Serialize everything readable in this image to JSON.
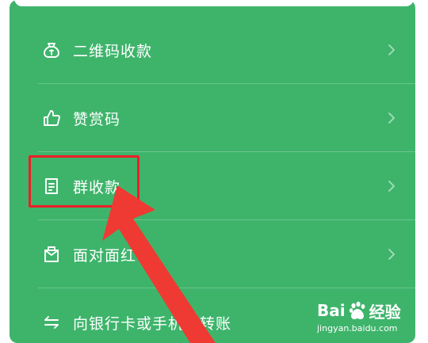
{
  "menu": {
    "items": [
      {
        "label": "二维码收款",
        "icon": "money-bag-icon"
      },
      {
        "label": "赞赏码",
        "icon": "thumbs-up-icon"
      },
      {
        "label": "群收款",
        "icon": "receipt-icon"
      },
      {
        "label": "面对面红包",
        "icon": "red-packet-icon"
      },
      {
        "label": "向银行卡或手机号转账",
        "icon": "transfer-arrows-icon"
      }
    ]
  },
  "watermark": {
    "brand_left": "Bai",
    "brand_right": "经验",
    "url": "jingyan.baidu.com"
  },
  "colors": {
    "panel": "#3eb46b",
    "highlight": "#ef1d28",
    "arrow": "#ee3a32"
  }
}
